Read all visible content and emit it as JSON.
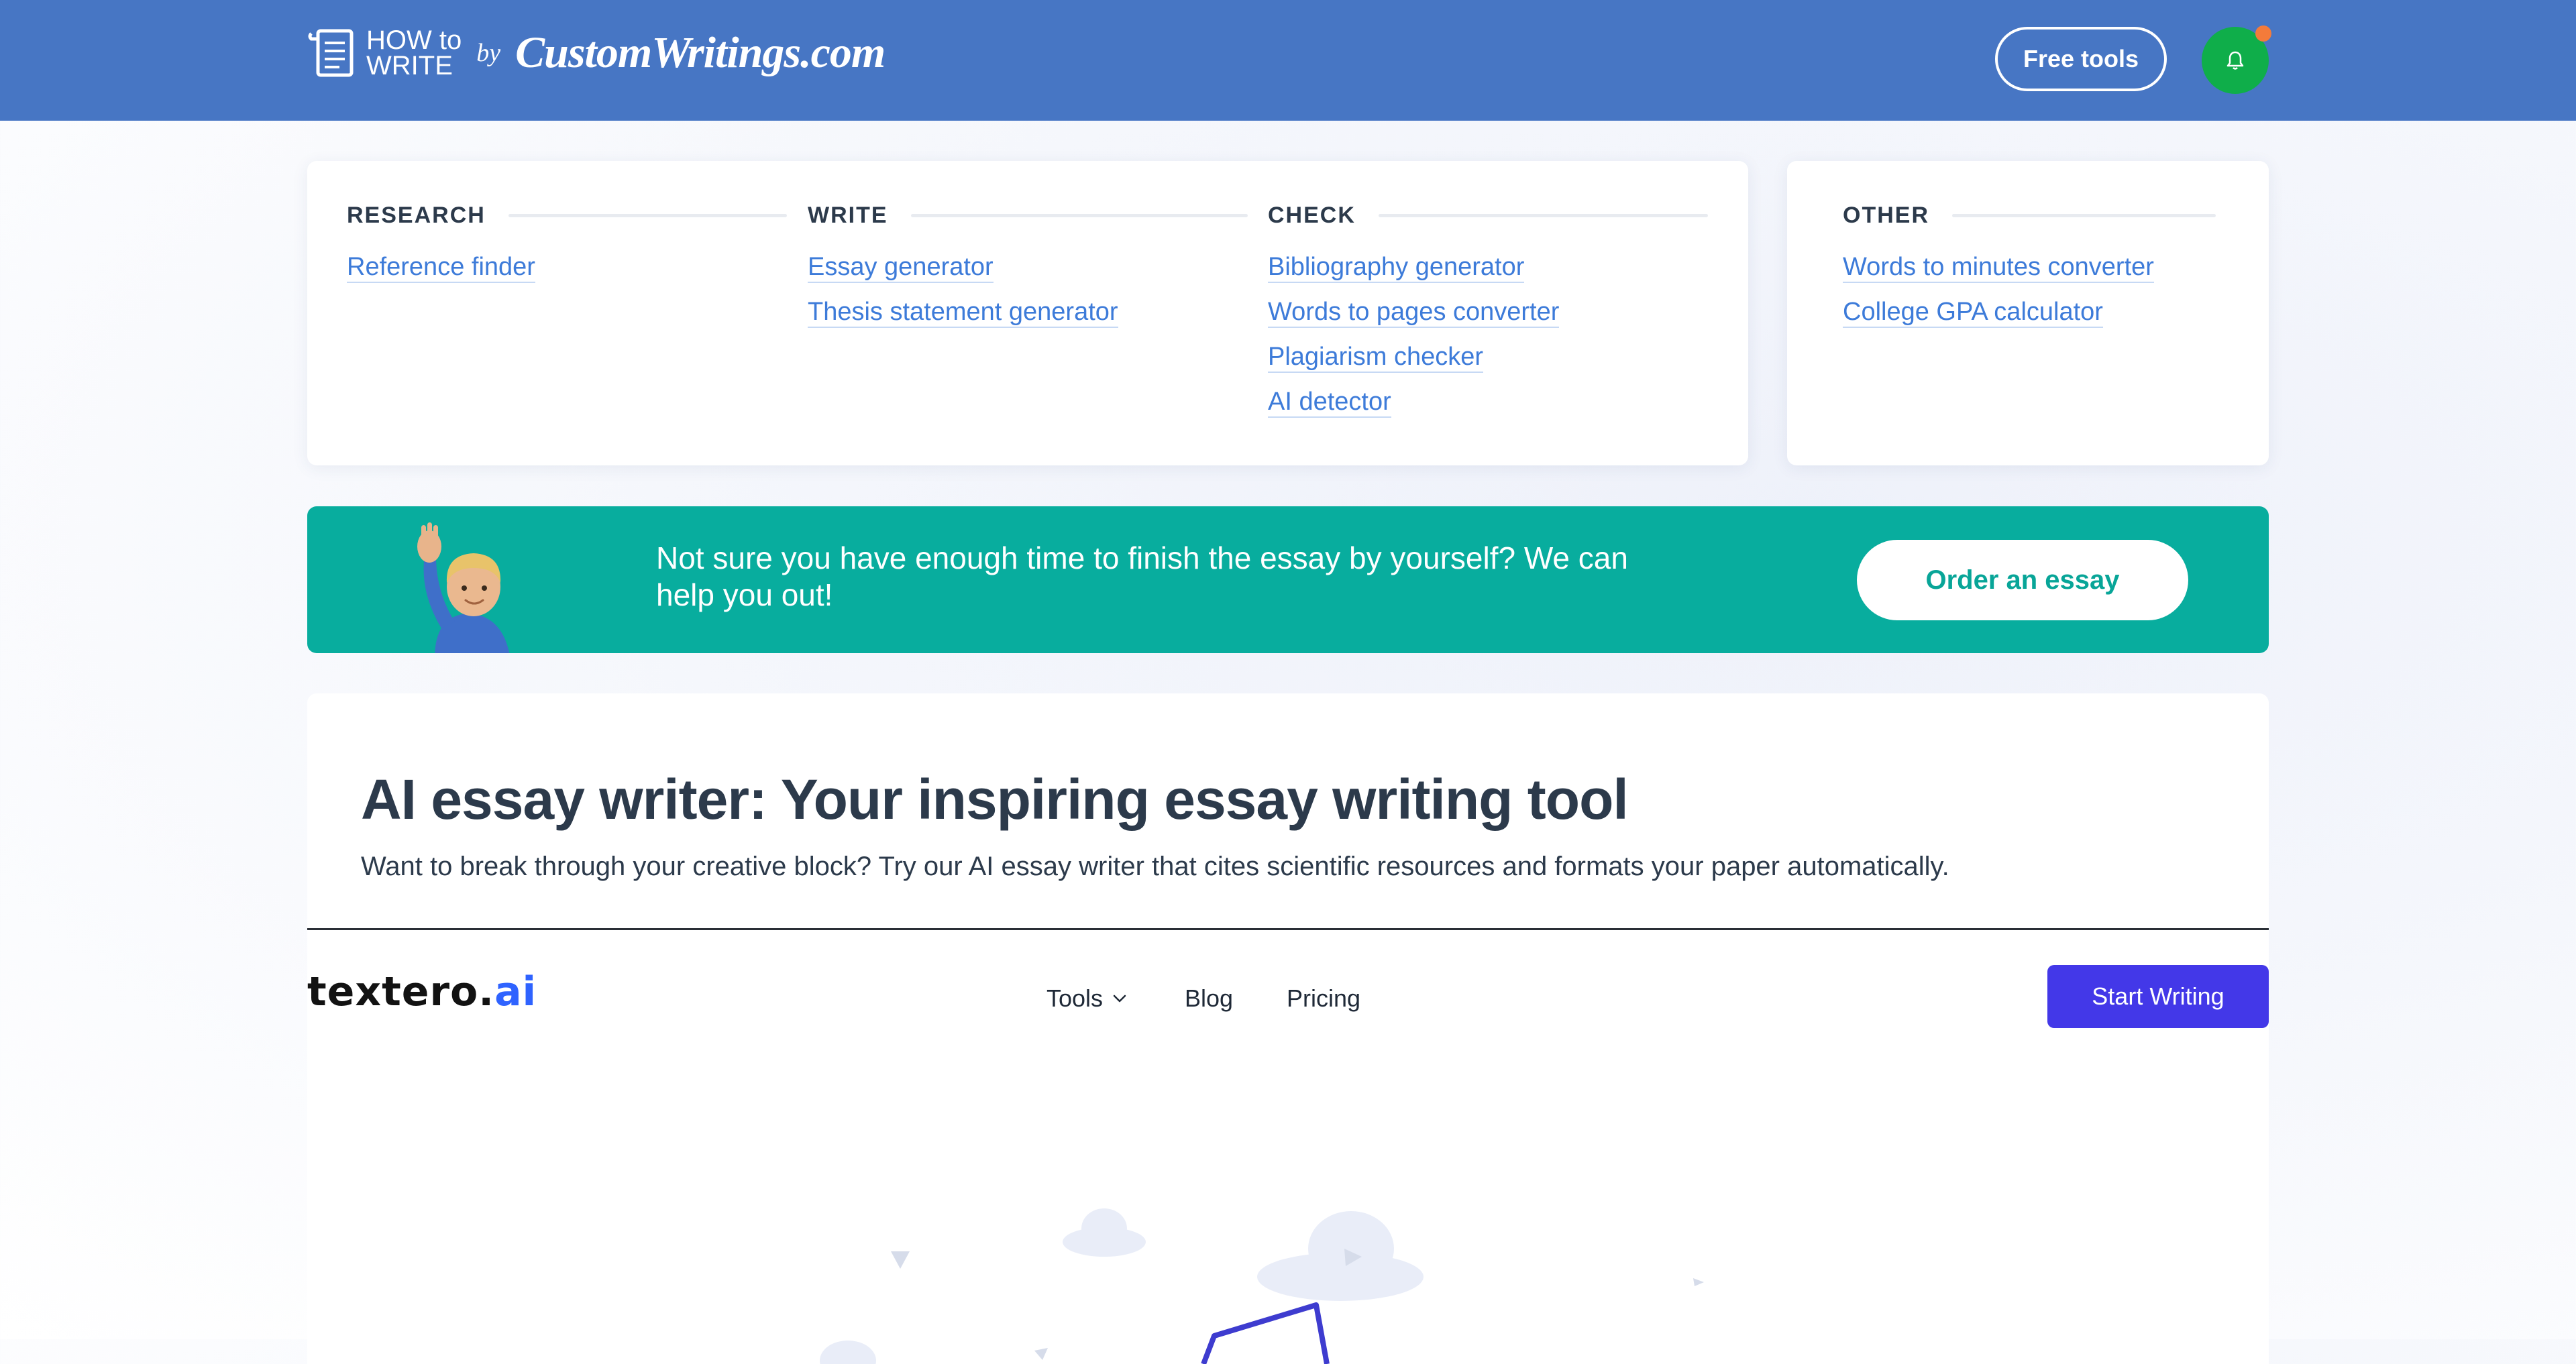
{
  "header": {
    "logo_how": "HOW to",
    "logo_write": "WRITE",
    "logo_by": "by",
    "logo_brand": "CustomWritings.com",
    "free_tools_label": "Free tools",
    "bell_icon": "bell-icon"
  },
  "tools": {
    "research": {
      "title": "RESEARCH",
      "links": [
        "Reference finder"
      ]
    },
    "write": {
      "title": "WRITE",
      "links": [
        "Essay generator",
        "Thesis statement generator"
      ]
    },
    "check": {
      "title": "CHECK",
      "links": [
        "Bibliography generator",
        "Words to pages converter",
        "Plagiarism checker",
        "AI detector"
      ]
    },
    "other": {
      "title": "OTHER",
      "links": [
        "Words to minutes converter",
        "College GPA calculator"
      ]
    }
  },
  "banner": {
    "text": "Not sure you have enough time to finish the essay by yourself? We can help you out!",
    "button_label": "Order an essay"
  },
  "main": {
    "title": "AI essay writer: Your inspiring essay writing tool",
    "subtitle": "Want to break through your creative block? Try our AI essay writer that cites scientific resources and formats your paper automatically."
  },
  "textero": {
    "logo_text": "textero.",
    "logo_ai": "ai",
    "nav": {
      "tools": "Tools",
      "blog": "Blog",
      "pricing": "Pricing"
    },
    "start_label": "Start Writing"
  },
  "colors": {
    "header_bg": "#4776c4",
    "banner_bg": "#08ad9e",
    "link": "#3d7bd9",
    "start_button": "#4338e8",
    "bell_bg": "#0fae4a"
  }
}
